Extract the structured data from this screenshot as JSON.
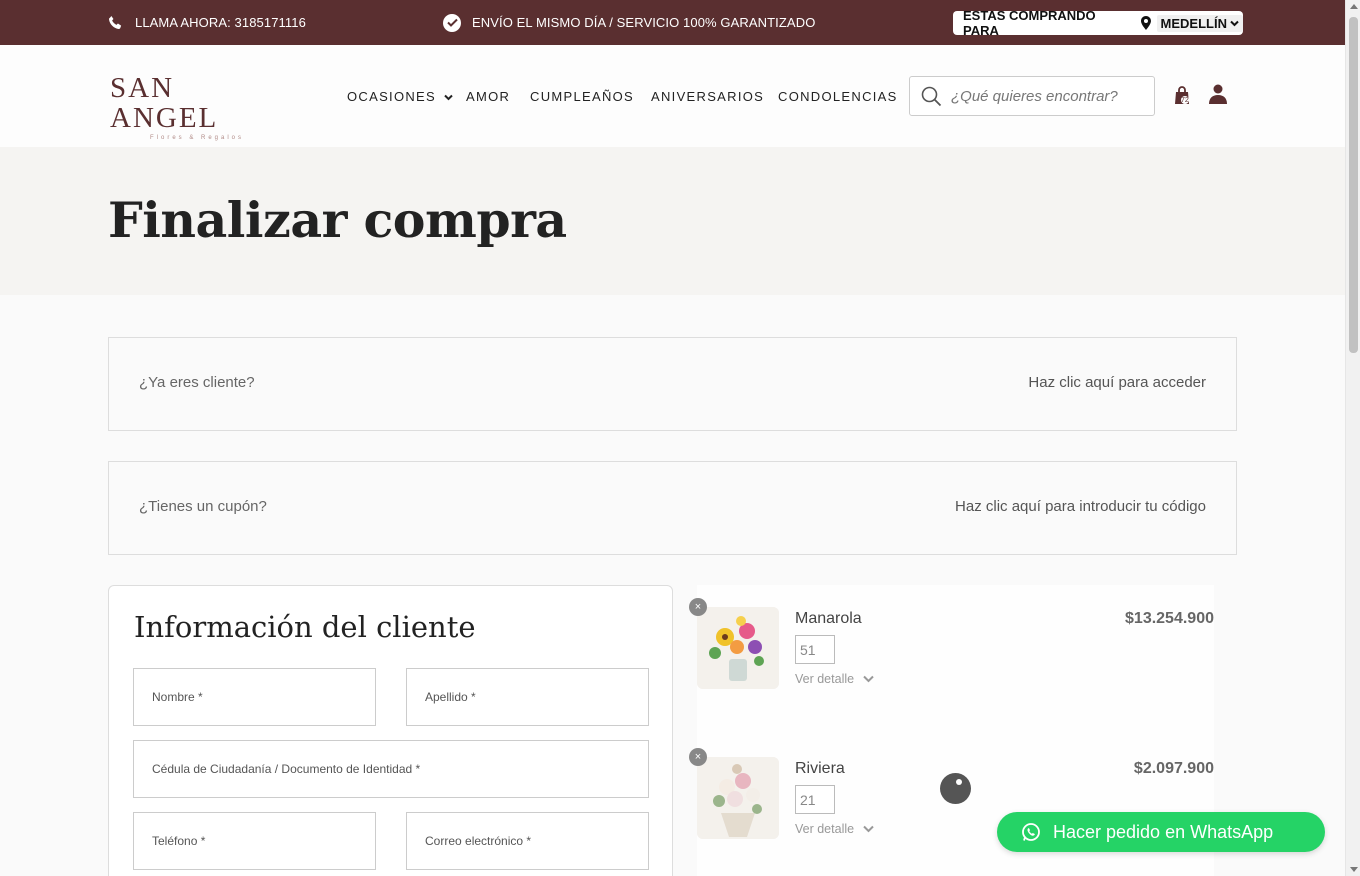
{
  "topbar": {
    "phone_text": "LLAMA AHORA: 3185171116",
    "shipping_text": "ENVÍO EL MISMO DÍA / SERVICIO 100% GARANTIZADO",
    "city_label": "ESTAS COMPRANDO PARA",
    "city_value": "MEDELLÍN",
    "bg_color": "#5a2f30"
  },
  "header": {
    "logo_text": "SAN ANGEL",
    "logo_sub": "Flores & Regalos",
    "nav": [
      "OCASIONES",
      "AMOR",
      "CUMPLEAÑOS",
      "ANIVERSARIOS",
      "CONDOLENCIAS"
    ],
    "search_placeholder": "¿Qué quieres encontrar?",
    "cart_count": "72"
  },
  "page": {
    "title": "Finalizar compra"
  },
  "notices": [
    {
      "question": "¿Ya eres cliente?",
      "link": "Haz clic aquí para acceder"
    },
    {
      "question": "¿Tienes un cupón?",
      "link": "Haz clic aquí para introducir tu código"
    }
  ],
  "customer_form": {
    "title": "Información del cliente",
    "first_name": "Nombre *",
    "last_name": "Apellido *",
    "document": "Cédula de Ciudadanía / Documento de Identidad *",
    "phone": "Teléfono *",
    "email": "Correo electrónico *"
  },
  "order_items": [
    {
      "name": "Manarola",
      "qty": "51",
      "detail": "Ver detalle",
      "price": "$13.254.900",
      "remove": "×"
    },
    {
      "name": "Riviera",
      "qty": "21",
      "detail": "Ver detalle",
      "price": "$2.097.900",
      "remove": "×"
    }
  ],
  "whatsapp": {
    "label": "Hacer pedido en WhatsApp",
    "color": "#25d366"
  }
}
